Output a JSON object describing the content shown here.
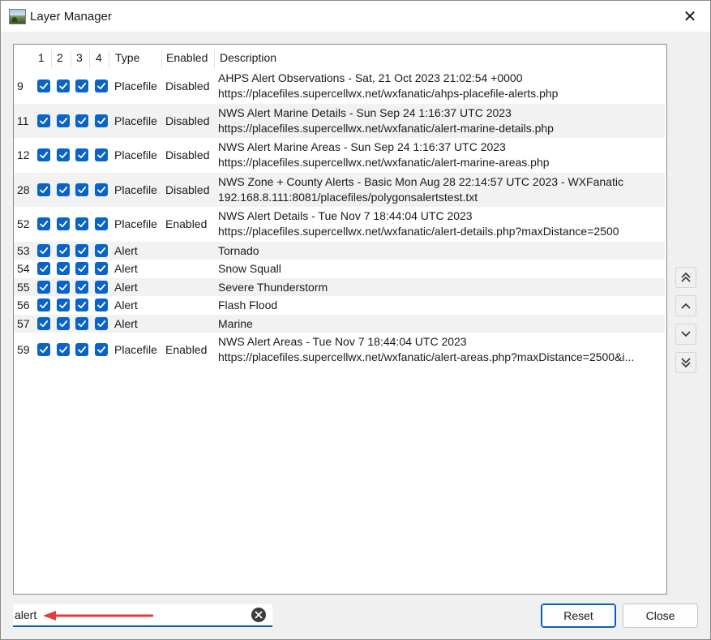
{
  "window": {
    "title": "Layer Manager",
    "close_glyph": "✕",
    "icon": "globe-map-icon"
  },
  "table": {
    "headers": {
      "c1": "1",
      "c2": "2",
      "c3": "3",
      "c4": "4",
      "type": "Type",
      "enabled": "Enabled",
      "description": "Description"
    },
    "rows": [
      {
        "id": "9",
        "type": "Placefile",
        "enabled": "Disabled",
        "desc1": "AHPS Alert Observations - Sat, 21 Oct 2023 21:02:54 +0000",
        "desc2": "https://placefiles.supercellwx.net/wxfanatic/ahps-placefile-alerts.php"
      },
      {
        "id": "11",
        "type": "Placefile",
        "enabled": "Disabled",
        "desc1": "NWS Alert Marine Details - Sun Sep 24 1:16:37 UTC 2023",
        "desc2": "https://placefiles.supercellwx.net/wxfanatic/alert-marine-details.php"
      },
      {
        "id": "12",
        "type": "Placefile",
        "enabled": "Disabled",
        "desc1": "NWS Alert Marine Areas - Sun Sep 24 1:16:37 UTC 2023",
        "desc2": "https://placefiles.supercellwx.net/wxfanatic/alert-marine-areas.php"
      },
      {
        "id": "28",
        "type": "Placefile",
        "enabled": "Disabled",
        "desc1": "NWS Zone + County Alerts - Basic Mon Aug 28 22:14:57 UTC 2023 - WXFanatic",
        "desc2": "192.168.8.111:8081/placefiles/polygonsalertstest.txt"
      },
      {
        "id": "52",
        "type": "Placefile",
        "enabled": "Enabled",
        "desc1": "NWS Alert Details - Tue Nov 7 18:44:04 UTC 2023",
        "desc2": "https://placefiles.supercellwx.net/wxfanatic/alert-details.php?maxDistance=2500"
      },
      {
        "id": "53",
        "type": "Alert",
        "enabled": "",
        "desc1": "Tornado",
        "desc2": ""
      },
      {
        "id": "54",
        "type": "Alert",
        "enabled": "",
        "desc1": "Snow Squall",
        "desc2": ""
      },
      {
        "id": "55",
        "type": "Alert",
        "enabled": "",
        "desc1": "Severe Thunderstorm",
        "desc2": ""
      },
      {
        "id": "56",
        "type": "Alert",
        "enabled": "",
        "desc1": "Flash Flood",
        "desc2": ""
      },
      {
        "id": "57",
        "type": "Alert",
        "enabled": "",
        "desc1": "Marine",
        "desc2": ""
      },
      {
        "id": "59",
        "type": "Placefile",
        "enabled": "Enabled",
        "desc1": "NWS Alert Areas - Tue Nov 7 18:44:04 UTC 2023",
        "desc2": "https://placefiles.supercellwx.net/wxfanatic/alert-areas.php?maxDistance=2500&i..."
      }
    ]
  },
  "side_buttons": [
    "move-to-top-icon",
    "move-up-icon",
    "move-down-icon",
    "move-to-bottom-icon"
  ],
  "filter": {
    "value": "alert"
  },
  "buttons": {
    "reset": "Reset",
    "close": "Close"
  },
  "colors": {
    "checkbox": "#0a64c8",
    "focus": "#0a5fb8",
    "annotation_arrow": "#e03c3c",
    "alt_row": "#f2f2f2"
  }
}
